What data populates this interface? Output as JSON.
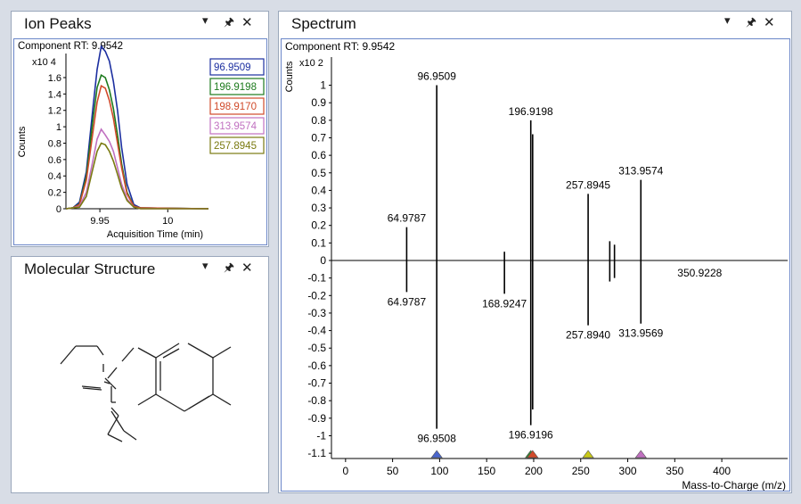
{
  "panels": {
    "ion_peaks": {
      "title": "Ion Peaks",
      "component_rt": "Component RT: 9.9542"
    },
    "molecular_structure": {
      "title": "Molecular Structure"
    },
    "spectrum": {
      "title": "Spectrum",
      "component_rt": "Component RT: 9.9542"
    }
  },
  "controls": {
    "dropdown_glyph": "▾",
    "pin_glyph": "🖈",
    "close_glyph": "✕"
  },
  "colors": {
    "frame": "#6a86c8",
    "ion1": "#1c2fa0",
    "ion2": "#1d7a1d",
    "ion3": "#d04a2a",
    "ion4": "#c070c0",
    "ion5": "#7a7a10"
  },
  "chart_data": [
    {
      "type": "line",
      "title": "",
      "xlabel": "Acquisition Time (min)",
      "ylabel": "Counts",
      "y_multiplier": "x10 4",
      "xlim": [
        9.925,
        10.03
      ],
      "ylim": [
        0,
        1.85
      ],
      "x_ticks": [
        9.95,
        10
      ],
      "x_tick_labels": [
        "9.95",
        "10"
      ],
      "y_ticks": [
        0,
        0.2,
        0.4,
        0.6,
        0.8,
        1,
        1.2,
        1.4,
        1.6
      ],
      "y_tick_labels": [
        "0",
        "0.2",
        "0.4",
        "0.6",
        "0.8",
        "1",
        "1.2",
        "1.4",
        "1.6"
      ],
      "x": [
        9.925,
        9.93,
        9.935,
        9.94,
        9.945,
        9.948,
        9.951,
        9.954,
        9.957,
        9.96,
        9.963,
        9.966,
        9.97,
        9.975,
        9.98,
        10.03
      ],
      "series": [
        {
          "name": "96.9509",
          "color": "#1c2fa0",
          "values": [
            0,
            0.01,
            0.08,
            0.45,
            1.25,
            1.7,
            1.98,
            1.92,
            1.8,
            1.55,
            1.2,
            0.75,
            0.3,
            0.05,
            0.01,
            0
          ]
        },
        {
          "name": "196.9198",
          "color": "#1d7a1d",
          "values": [
            0,
            0.01,
            0.06,
            0.4,
            1.1,
            1.48,
            1.63,
            1.6,
            1.45,
            1.22,
            0.9,
            0.55,
            0.2,
            0.03,
            0.01,
            0
          ]
        },
        {
          "name": "198.9170",
          "color": "#d04a2a",
          "values": [
            0,
            0.01,
            0.05,
            0.35,
            0.95,
            1.3,
            1.5,
            1.47,
            1.32,
            1.1,
            0.8,
            0.5,
            0.18,
            0.03,
            0.01,
            0
          ]
        },
        {
          "name": "313.9574",
          "color": "#c070c0",
          "values": [
            0,
            0.01,
            0.03,
            0.2,
            0.6,
            0.85,
            0.97,
            0.9,
            0.82,
            0.7,
            0.5,
            0.3,
            0.12,
            0.02,
            0,
            0
          ]
        },
        {
          "name": "257.8945",
          "color": "#7a7a10",
          "values": [
            0,
            0.01,
            0.02,
            0.15,
            0.5,
            0.7,
            0.8,
            0.78,
            0.7,
            0.58,
            0.42,
            0.25,
            0.1,
            0.02,
            0,
            0
          ]
        }
      ]
    },
    {
      "type": "bar",
      "title": "",
      "xlabel": "Mass-to-Charge (m/z)",
      "ylabel": "Counts",
      "y_multiplier": "x10 2",
      "xlim": [
        -15,
        470
      ],
      "ylim": [
        -1.13,
        1.13
      ],
      "x_ticks": [
        0,
        50,
        100,
        150,
        200,
        250,
        300,
        350,
        400
      ],
      "x_tick_labels": [
        "0",
        "50",
        "100",
        "150",
        "200",
        "250",
        "300",
        "350",
        "400"
      ],
      "y_ticks": [
        1,
        0.9,
        0.8,
        0.7,
        0.6,
        0.5,
        0.4,
        0.3,
        0.2,
        0.1,
        0,
        -0.1,
        -0.2,
        -0.3,
        -0.4,
        -0.5,
        -0.6,
        -0.7,
        -0.8,
        -0.9,
        -1,
        -1.1
      ],
      "y_tick_labels": [
        "1",
        "0.9",
        "0.8",
        "0.7",
        "0.6",
        "0.5",
        "0.4",
        "0.3",
        "0.2",
        "0.1",
        "0",
        "-0.1",
        "-0.2",
        "-0.3",
        "-0.4",
        "-0.5",
        "-0.6",
        "-0.7",
        "-0.8",
        "-0.9",
        "-1",
        "-1.1"
      ],
      "peaks_top": [
        {
          "mz": 96.9509,
          "value": 1.0,
          "label": "96.9509"
        },
        {
          "mz": 196.9198,
          "value": 0.8,
          "label": "196.9198"
        },
        {
          "mz": 198.917,
          "value": 0.72
        },
        {
          "mz": 257.8945,
          "value": 0.38,
          "label": "257.8945"
        },
        {
          "mz": 313.9574,
          "value": 0.46,
          "label": "313.9574"
        },
        {
          "mz": 64.9787,
          "value": 0.19,
          "label": "64.9787"
        },
        {
          "mz": 168.92,
          "value": 0.05
        },
        {
          "mz": 280.9,
          "value": 0.11
        },
        {
          "mz": 285.9,
          "value": 0.09
        }
      ],
      "peaks_bottom": [
        {
          "mz": 96.9508,
          "value": -0.96,
          "label": "96.9508"
        },
        {
          "mz": 196.9196,
          "value": -0.94,
          "label": "196.9196"
        },
        {
          "mz": 198.916,
          "value": -0.85
        },
        {
          "mz": 257.894,
          "value": -0.37,
          "label": "257.8940"
        },
        {
          "mz": 313.9569,
          "value": -0.36,
          "label": "313.9569"
        },
        {
          "mz": 64.9787,
          "value": -0.18,
          "label": "64.9787"
        },
        {
          "mz": 168.9247,
          "value": -0.19,
          "label": "168.9247"
        },
        {
          "mz": 280.9,
          "value": -0.12
        },
        {
          "mz": 285.9,
          "value": -0.1
        }
      ],
      "annotations": [
        {
          "mz": 350.9228,
          "value": -0.05,
          "label": "350.9228"
        }
      ],
      "precursor_markers": [
        {
          "mz": 96.95,
          "color": "#4a66cc"
        },
        {
          "mz": 196.92,
          "color": "#2f8a2f"
        },
        {
          "mz": 198.92,
          "color": "#d04a2a"
        },
        {
          "mz": 257.89,
          "color": "#c8c818"
        },
        {
          "mz": 313.96,
          "color": "#c070c0"
        }
      ]
    }
  ]
}
